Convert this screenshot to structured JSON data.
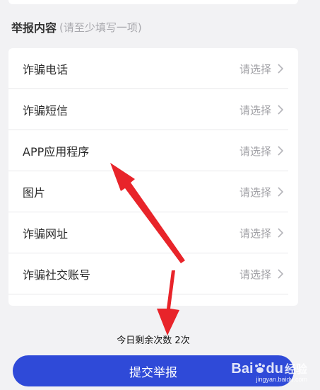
{
  "section": {
    "title": "举报内容",
    "hint": "(请至少填写一项)"
  },
  "items": [
    {
      "label": "诈骗电话",
      "value": "请选择"
    },
    {
      "label": "诈骗短信",
      "value": "请选择"
    },
    {
      "label": "APP应用程序",
      "value": "请选择"
    },
    {
      "label": "图片",
      "value": "请选择"
    },
    {
      "label": "诈骗网址",
      "value": "请选择"
    },
    {
      "label": "诈骗社交账号",
      "value": "请选择"
    }
  ],
  "remaining_text": "今日剩余次数 2次",
  "submit_label": "提交举报",
  "watermark": {
    "brand": "Bai",
    "brand_mark": "du",
    "sub": "经验",
    "url": "jingyan.baidu.com"
  },
  "colors": {
    "primary": "#2f4ad8",
    "arrow": "#e8242a",
    "background": "#f2f2f4"
  }
}
